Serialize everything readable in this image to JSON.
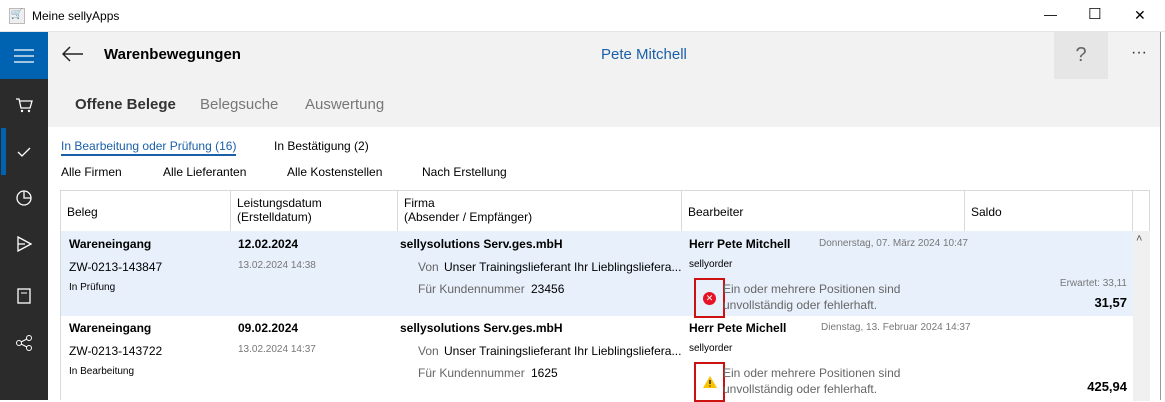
{
  "window": {
    "title": "Meine sellyApps",
    "minimize": "—",
    "maximize": "☐",
    "close": "✕"
  },
  "header": {
    "title": "Warenbewegungen",
    "user": "Pete Mitchell",
    "help": "?",
    "more": "···"
  },
  "tabs": [
    {
      "label": "Offene Belege"
    },
    {
      "label": "Belegsuche"
    },
    {
      "label": "Auswertung"
    }
  ],
  "filters": {
    "status": [
      {
        "label": "In Bearbeitung oder Prüfung (16)"
      },
      {
        "label": "In Bestätigung (2)"
      }
    ],
    "options": [
      {
        "label": "Alle Firmen"
      },
      {
        "label": "Alle Lieferanten"
      },
      {
        "label": "Alle Kostenstellen"
      },
      {
        "label": "Nach Erstellung"
      }
    ]
  },
  "columns": [
    "Beleg",
    "Leistungsdatum\n(Erstelldatum)",
    "Firma\n(Absender / Empfänger)",
    "Bearbeiter",
    "Saldo"
  ],
  "rows": [
    {
      "type": "Wareneingang",
      "number": "ZW-0213-143847",
      "status": "In Prüfung",
      "date": "12.02.2024",
      "created": "13.02.2024 14:38",
      "company": "sellysolutions Serv.ges.mbH",
      "von_label": "Von",
      "von": "Unser Trainingslieferant Ihr Lieblingsliefera...",
      "kunde_label": "Für Kundennummer",
      "kunde": "23456",
      "editor": "Herr Pete Mitchell",
      "edited": "Donnerstag, 07. März 2024 10:47",
      "app": "sellyorder",
      "message": "Ein oder mehrere Positionen sind unvollständig oder fehlerhaft.",
      "expected": "Erwartet: 33,11",
      "saldo": "31,57",
      "icon": "error-icon"
    },
    {
      "type": "Wareneingang",
      "number": "ZW-0213-143722",
      "status": "In Bearbeitung",
      "date": "09.02.2024",
      "created": "13.02.2024 14:37",
      "company": "sellysolutions Serv.ges.mbH",
      "von_label": "Von",
      "von": "Unser Trainingslieferant Ihr Lieblingsliefera...",
      "kunde_label": "Für Kundennummer",
      "kunde": "1625",
      "editor": "Herr Pete Michell",
      "edited": "Dienstag, 13. Februar 2024 14:37",
      "app": "sellyorder",
      "message": "Ein oder mehrere Positionen sind unvollständig oder fehlerhaft.",
      "saldo": "425,94",
      "icon": "warning-icon"
    }
  ]
}
